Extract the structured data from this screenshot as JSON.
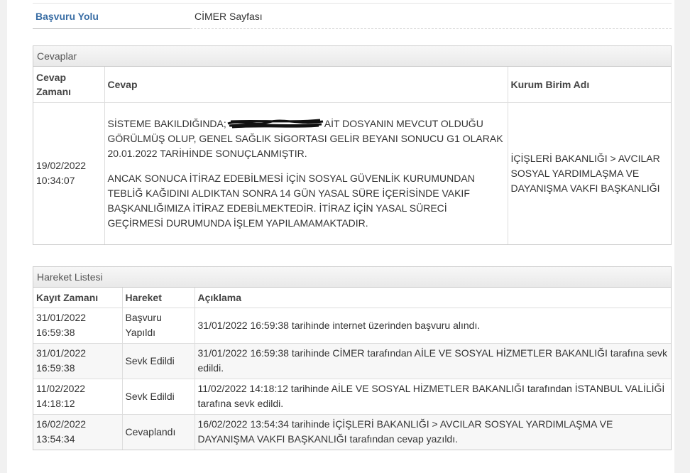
{
  "info": {
    "label": "Başvuru Yolu",
    "value": "CİMER Sayfası"
  },
  "answers_panel": {
    "title": "Cevaplar",
    "headers": {
      "time": "Cevap\nZamanı",
      "answer": "Cevap",
      "unit": "Kurum Birim Adı"
    },
    "row": {
      "time_date": "19/02/2022",
      "time_clock": "10:34:07",
      "answer_line1_before": "SİSTEME BAKILDIĞINDA;",
      "answer_line1_after": "AİT DOSYANIN MEVCUT OLDUĞU",
      "answer_p1_rest": "GÖRÜLMÜŞ OLUP, GENEL SAĞLIK SİGORTASI GELİR BEYANI SONUCU G1 OLARAK 20.01.2022 TARİHİNDE SONUÇLANMIŞTIR.",
      "answer_p2": "ANCAK SONUCA İTİRAZ EDEBİLMESİ İÇİN SOSYAL GÜVENLİK KURUMUNDAN TEBLİĞ KAĞIDINI ALDIKTAN SONRA 14 GÜN YASAL SÜRE İÇERİSİNDE VAKIF BAŞKANLIĞIMIZA İTİRAZ EDEBİLMEKTEDİR. İTİRAZ İÇİN YASAL SÜRECİ GEÇİRMESİ DURUMUNDA İŞLEM YAPILAMAMAKTADIR.",
      "unit": "İÇİŞLERİ BAKANLIĞI > AVCILAR SOSYAL YARDIMLAŞMA VE DAYANIŞMA VAKFI BAŞKANLIĞI"
    }
  },
  "movements_panel": {
    "title": "Hareket Listesi",
    "headers": {
      "time": "Kayıt Zamanı",
      "action": "Hareket",
      "desc": "Açıklama"
    },
    "rows": [
      {
        "date": "31/01/2022",
        "clock": "16:59:38",
        "action": "Başvuru Yapıldı",
        "desc": "31/01/2022 16:59:38 tarihinde internet üzerinden başvuru alındı."
      },
      {
        "date": "31/01/2022",
        "clock": "16:59:38",
        "action": "Sevk Edildi",
        "desc": "31/01/2022 16:59:38 tarihinde CİMER tarafından AİLE VE SOSYAL HİZMETLER BAKANLIĞI tarafına sevk edildi."
      },
      {
        "date": "11/02/2022",
        "clock": "14:18:12",
        "action": "Sevk Edildi",
        "desc": "11/02/2022 14:18:12 tarihinde AİLE VE SOSYAL HİZMETLER BAKANLIĞI tarafından İSTANBUL VALİLİĞİ tarafına sevk edildi."
      },
      {
        "date": "16/02/2022",
        "clock": "13:54:34",
        "action": "Cevaplandı",
        "desc": "16/02/2022 13:54:34 tarihinde İÇİŞLERİ BAKANLIĞI > AVCILAR SOSYAL YARDIMLAŞMA VE DAYANIŞMA VAKFI BAŞKANLIĞI tarafından cevap yazıldı."
      }
    ]
  }
}
